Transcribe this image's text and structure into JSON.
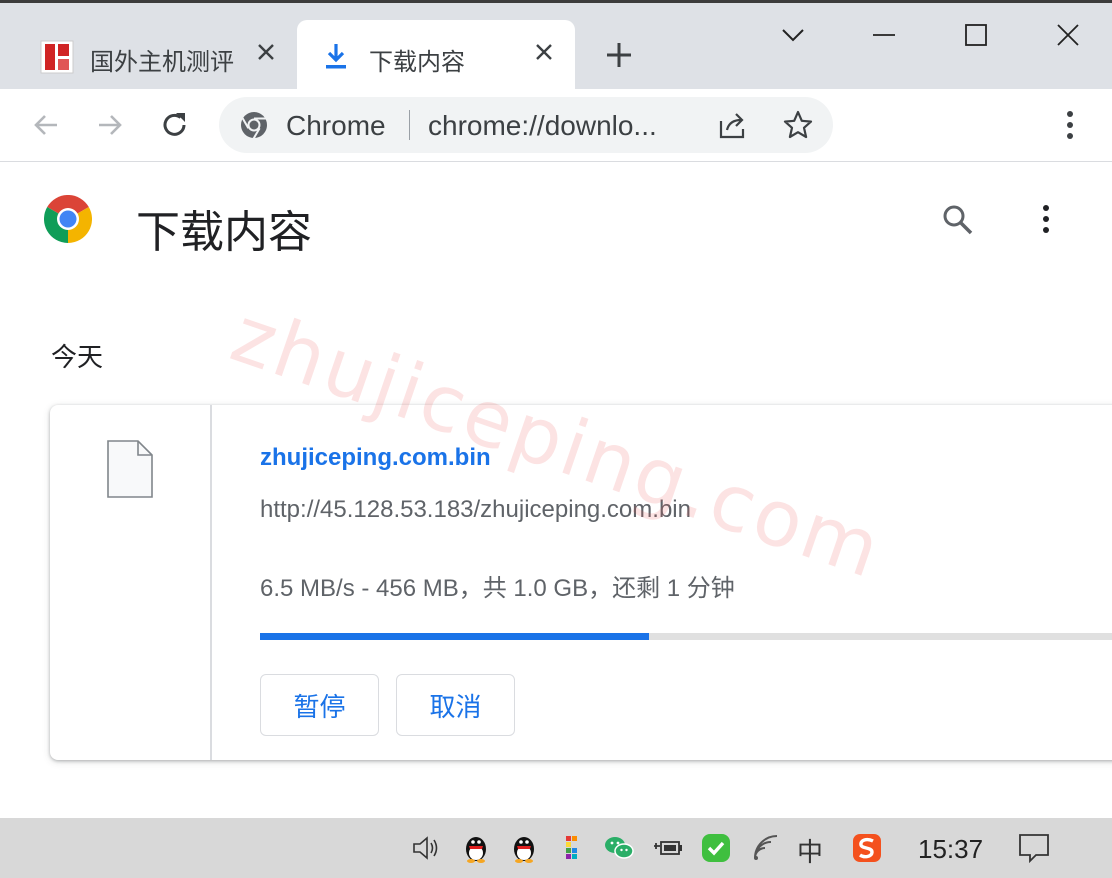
{
  "tabs": [
    {
      "title": "国外主机测评"
    },
    {
      "title": "下载内容"
    }
  ],
  "omnibox": {
    "site": "Chrome",
    "url": "chrome://downlo..."
  },
  "page": {
    "title": "下载内容",
    "section": "今天"
  },
  "download": {
    "file_name": "zhujiceping.com.bin",
    "url": "http://45.128.53.183/zhujiceping.com.bin",
    "status": "6.5 MB/s - 456 MB，共 1.0 GB，还剩 1 分钟",
    "progress_fraction": 0.456,
    "pause_label": "暂停",
    "cancel_label": "取消"
  },
  "watermark": "zhujiceping.com",
  "taskbar": {
    "clock": "15:37",
    "ime": "中"
  },
  "colors": {
    "accent": "#1a73e8",
    "watermark": "#ec5050"
  }
}
